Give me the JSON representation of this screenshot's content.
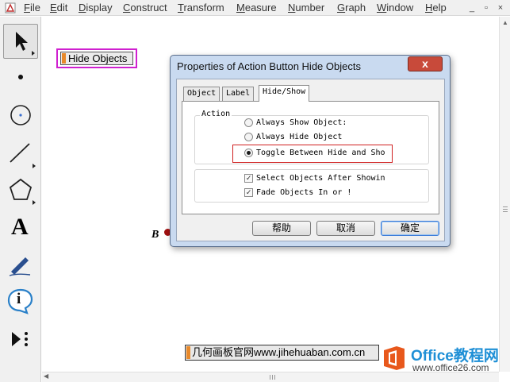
{
  "menubar": {
    "items": [
      {
        "label": "File",
        "accel": "F",
        "rest": "ile"
      },
      {
        "label": "Edit",
        "accel": "E",
        "rest": "dit"
      },
      {
        "label": "Display",
        "accel": "D",
        "rest": "isplay"
      },
      {
        "label": "Construct",
        "accel": "C",
        "rest": "onstruct"
      },
      {
        "label": "Transform",
        "accel": "T",
        "rest": "ransform"
      },
      {
        "label": "Measure",
        "accel": "M",
        "rest": "easure"
      },
      {
        "label": "Number",
        "accel": "N",
        "rest": "umber"
      },
      {
        "label": "Graph",
        "accel": "G",
        "rest": "raph"
      },
      {
        "label": "Window",
        "accel": "W",
        "rest": "indow"
      },
      {
        "label": "Help",
        "accel": "H",
        "rest": "elp"
      }
    ],
    "window_buttons": {
      "minimize": "_",
      "restore": "▫",
      "close": "×"
    }
  },
  "toolbox": {
    "tools": [
      {
        "name": "arrow-tool",
        "icon": "arrow-icon",
        "selected": true
      },
      {
        "name": "point-tool",
        "icon": "point-icon",
        "selected": false
      },
      {
        "name": "compass-tool",
        "icon": "compass-icon",
        "selected": false
      },
      {
        "name": "straightedge-tool",
        "icon": "straightedge-icon",
        "selected": false
      },
      {
        "name": "polygon-tool",
        "icon": "polygon-icon",
        "selected": false
      },
      {
        "name": "text-tool",
        "icon": "text-icon",
        "glyph": "A",
        "selected": false
      },
      {
        "name": "marker-tool",
        "icon": "marker-icon",
        "selected": false
      },
      {
        "name": "information-tool",
        "icon": "information-icon",
        "glyph": "i",
        "selected": false
      },
      {
        "name": "custom-tool",
        "icon": "custom-tool-icon",
        "selected": false
      }
    ]
  },
  "canvas": {
    "action_button_label": "Hide Objects",
    "point_label": "B",
    "watermark_text": "几何画板官网www.jihehuaban.com.cn",
    "brand_name": "Office教程网",
    "brand_url": "www.office26.com"
  },
  "dialog": {
    "title": "Properties of Action Button Hide Objects",
    "close_glyph": "x",
    "tabs": [
      {
        "label": "Object",
        "active": false
      },
      {
        "label": "Label",
        "active": false
      },
      {
        "label": "Hide/Show",
        "active": true
      }
    ],
    "action_group_label": "Action",
    "radios": [
      {
        "label": "Always Show Object:",
        "checked": false
      },
      {
        "label": "Always Hide Object",
        "checked": false
      },
      {
        "label": "Toggle Between Hide and Sho",
        "checked": true
      }
    ],
    "checkboxes": [
      {
        "label": "Select Objects After Showin",
        "checked": true
      },
      {
        "label": "Fade Objects In or !",
        "checked": true
      }
    ],
    "buttons": {
      "help": "帮助",
      "cancel": "取消",
      "ok": "确定"
    }
  },
  "colors": {
    "accent_orange": "#e8892a",
    "highlight_red": "#d02020",
    "selection_magenta": "#d020d0",
    "point_red": "#a01010",
    "brand_blue": "#1e8fd6"
  }
}
